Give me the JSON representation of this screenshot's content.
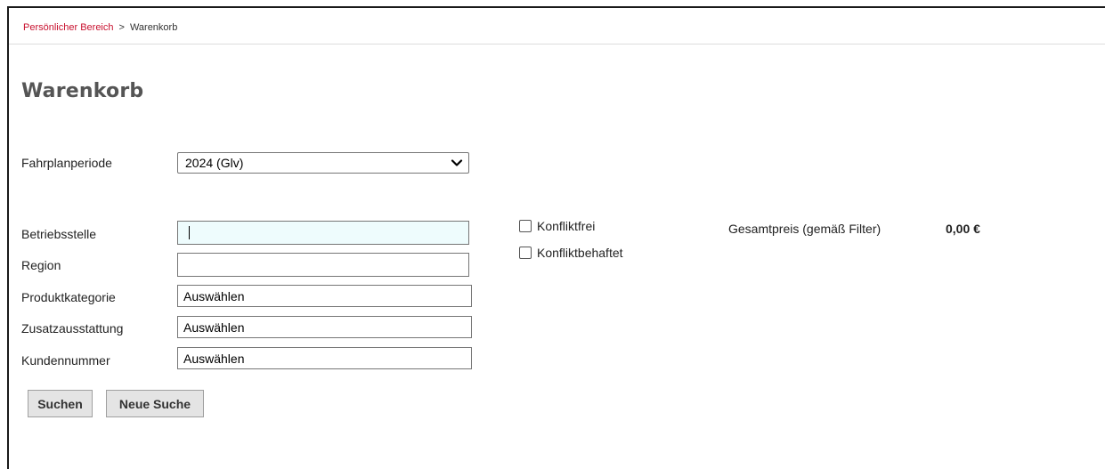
{
  "breadcrumb": {
    "parent": "Persönlicher Bereich",
    "separator": ">",
    "current": "Warenkorb"
  },
  "page": {
    "title": "Warenkorb"
  },
  "filters": {
    "period": {
      "label": "Fahrplanperiode",
      "value": "2024 (Glv)"
    },
    "betriebsstelle": {
      "label": "Betriebsstelle",
      "value": ""
    },
    "region": {
      "label": "Region",
      "value": ""
    },
    "produktkategorie": {
      "label": "Produktkategorie",
      "value": "Auswählen"
    },
    "zusatzausstattung": {
      "label": "Zusatzausstattung",
      "value": "Auswählen"
    },
    "kundennummer": {
      "label": "Kundennummer",
      "value": "Auswählen"
    }
  },
  "checkboxes": [
    {
      "label": "Konfliktfrei",
      "checked": false
    },
    {
      "label": "Konfliktbehaftet",
      "checked": false
    }
  ],
  "price": {
    "label": "Gesamtpreis (gemäß Filter)",
    "value": "0,00 €"
  },
  "buttons": {
    "search": "Suchen",
    "new_search": "Neue Suche"
  },
  "icons": {
    "dropdown": "chevron-down-icon"
  },
  "colors": {
    "link": "#c8102e",
    "focus_bg": "#eefcfd",
    "button_bg": "#e4e4e4"
  }
}
